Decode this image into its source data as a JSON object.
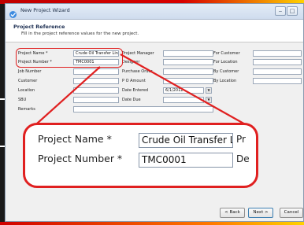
{
  "window": {
    "title": "New Project Wizard",
    "minimize": "‒",
    "maximize": "□",
    "close": "✕"
  },
  "header": {
    "title": "Project Reference",
    "subtitle": "Fill in the project reference values for the new project."
  },
  "form": {
    "project_name_label": "Project Name *",
    "project_name_value": "Crude Oil Transfer Line",
    "project_number_label": "Project Number *",
    "project_number_value": "TMC0001",
    "job_number_label": "Job Number",
    "customer_label": "Customer",
    "location_label": "Location",
    "sbu_label": "SBU",
    "remarks_label": "Remarks",
    "project_manager_label": "Project Manager",
    "designer_label": "Designer",
    "purchase_order_label": "Purchase Order",
    "po_amount_label": "P O Amount",
    "date_entered_label": "Date Entered",
    "date_entered_value": "6/1/2012",
    "date_due_label": "Date Due",
    "for_customer_label": "For Customer",
    "for_location_label": "For Location",
    "by_customer_label": "By Customer",
    "by_location_label": "By Location"
  },
  "zoom": {
    "project_name_label": "Project Name *",
    "project_name_value": "Crude Oil Transfer Line",
    "project_number_label": "Project Number *",
    "project_number_value": "TMC0001",
    "cut_label_1": "Pr",
    "cut_label_2": "De"
  },
  "buttons": {
    "back": "< Back",
    "next": "Next >",
    "cancel": "Cancel"
  },
  "colors": {
    "highlight": "#e02020",
    "stripe": "#d80000",
    "accent": "#ffd200"
  },
  "icons": {
    "window": "wizard-icon"
  }
}
